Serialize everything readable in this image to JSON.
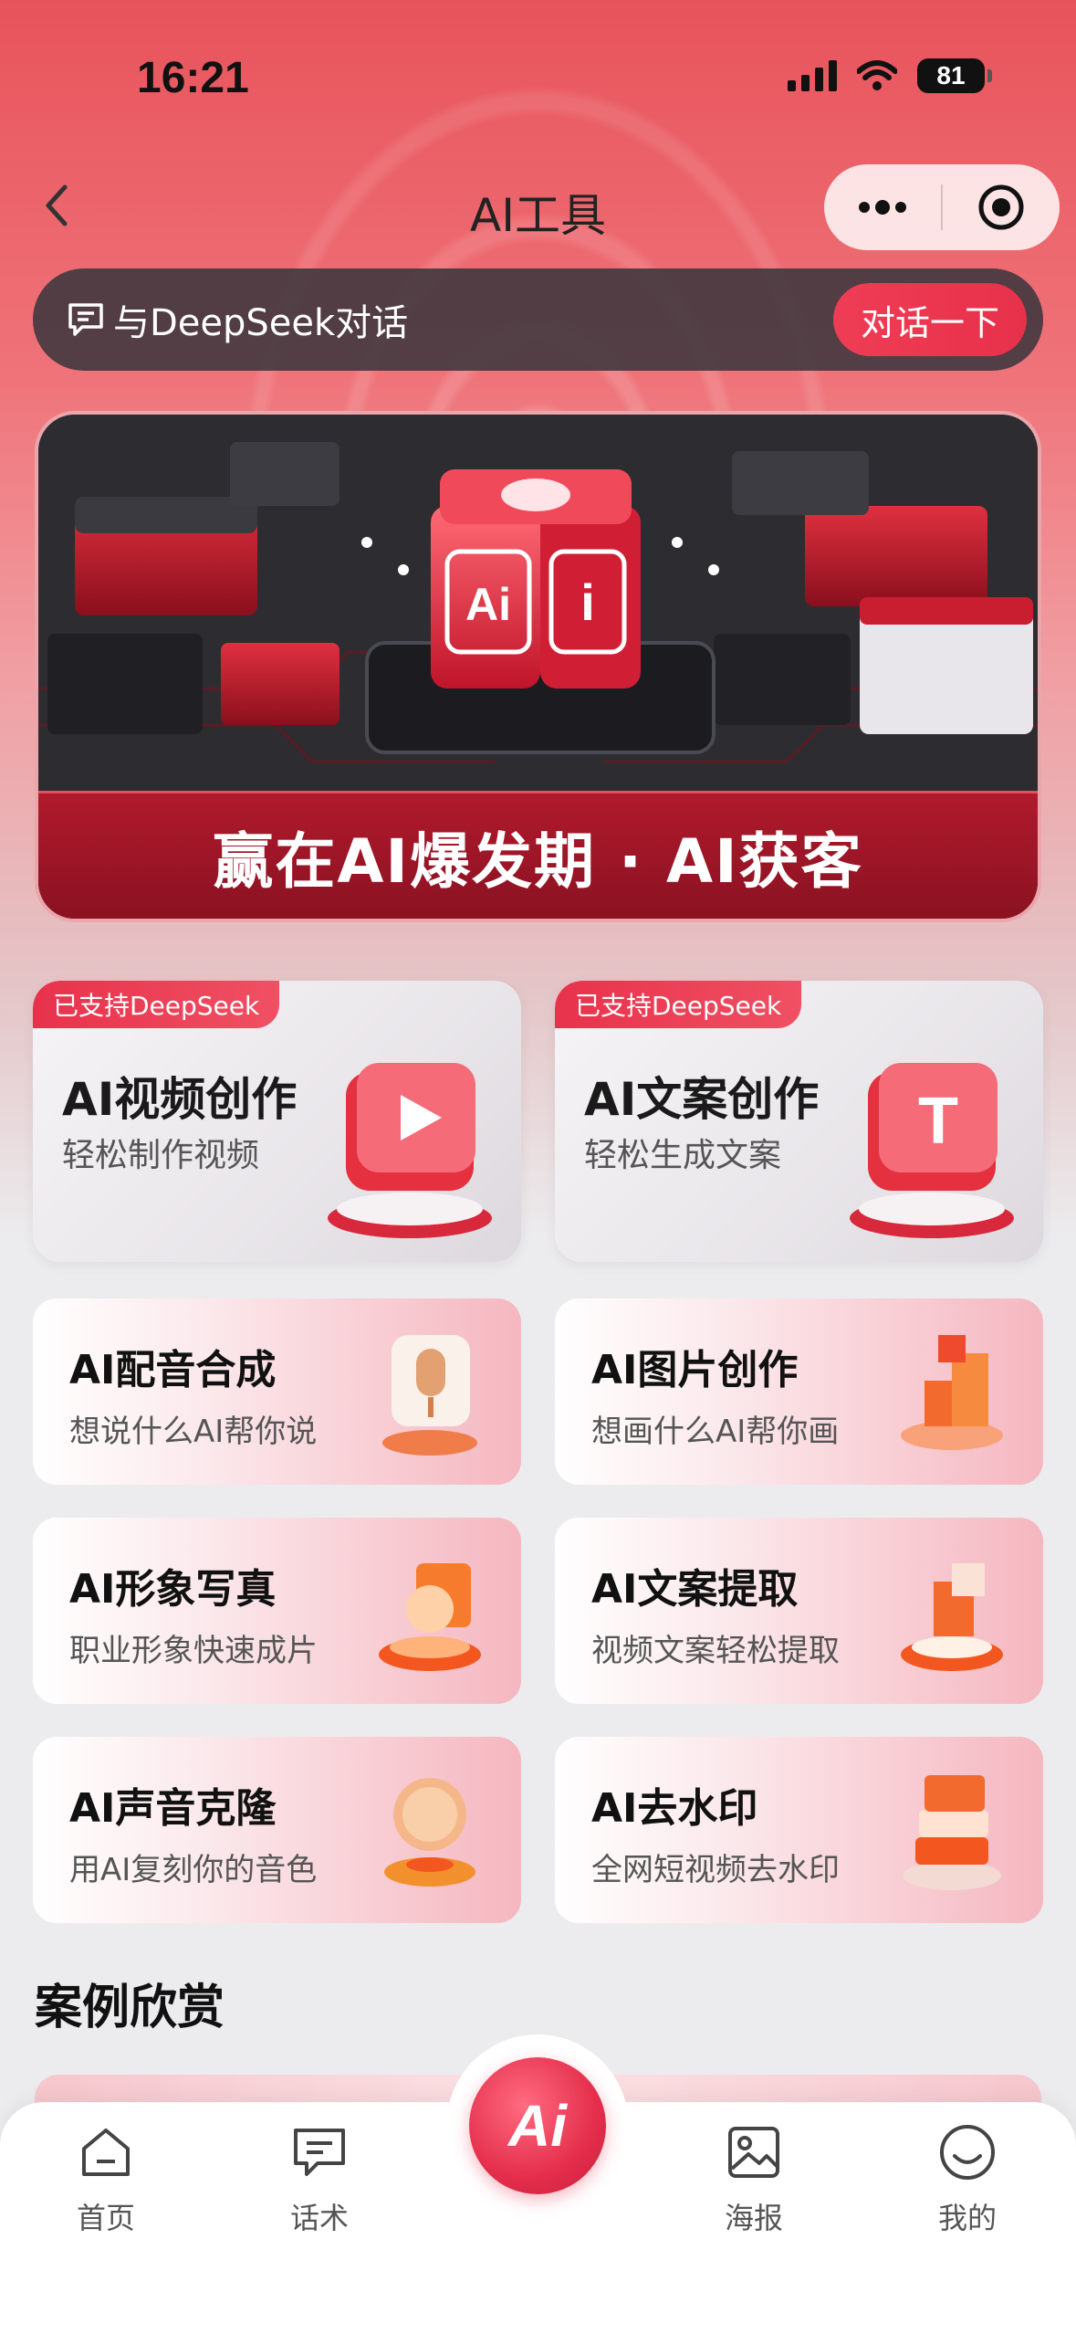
{
  "status": {
    "time": "16:21",
    "battery": "81"
  },
  "nav": {
    "title": "AI工具",
    "back_icon": "chevron-left-icon",
    "more_icon": "more-icon",
    "close_icon": "target-icon"
  },
  "deepseek": {
    "label": "与DeepSeek对话",
    "button": "对话一下"
  },
  "banner": {
    "caption": "赢在AI爆发期 · AI获客"
  },
  "feature_cards": [
    {
      "tag": "已支持DeepSeek",
      "title": "AI视频创作",
      "subtitle": "轻松制作视频",
      "icon": "play-icon"
    },
    {
      "tag": "已支持DeepSeek",
      "title": "AI文案创作",
      "subtitle": "轻松生成文案",
      "icon": "text-icon"
    }
  ],
  "tools": [
    {
      "title": "AI配音合成",
      "subtitle": "想说什么AI帮你说",
      "icon": "microphone-icon"
    },
    {
      "title": "AI图片创作",
      "subtitle": "想画什么AI帮你画",
      "icon": "image-icon"
    },
    {
      "title": "AI形象写真",
      "subtitle": "职业形象快速成片",
      "icon": "portrait-icon"
    },
    {
      "title": "AI文案提取",
      "subtitle": "视频文案轻松提取",
      "icon": "extract-icon"
    },
    {
      "title": "AI声音克隆",
      "subtitle": "用AI复刻你的音色",
      "icon": "voice-clone-icon"
    },
    {
      "title": "AI去水印",
      "subtitle": "全网短视频去水印",
      "icon": "watermark-icon"
    }
  ],
  "section": {
    "title": "案例欣赏"
  },
  "tabbar": {
    "items": [
      {
        "label": "首页",
        "icon": "home-icon"
      },
      {
        "label": "话术",
        "icon": "chat-icon"
      },
      {
        "label": "Ai",
        "icon": "ai-icon"
      },
      {
        "label": "海报",
        "icon": "poster-icon"
      },
      {
        "label": "我的",
        "icon": "profile-icon"
      }
    ]
  },
  "colors": {
    "accent": "#e8324c",
    "bar": "#3c373e"
  }
}
